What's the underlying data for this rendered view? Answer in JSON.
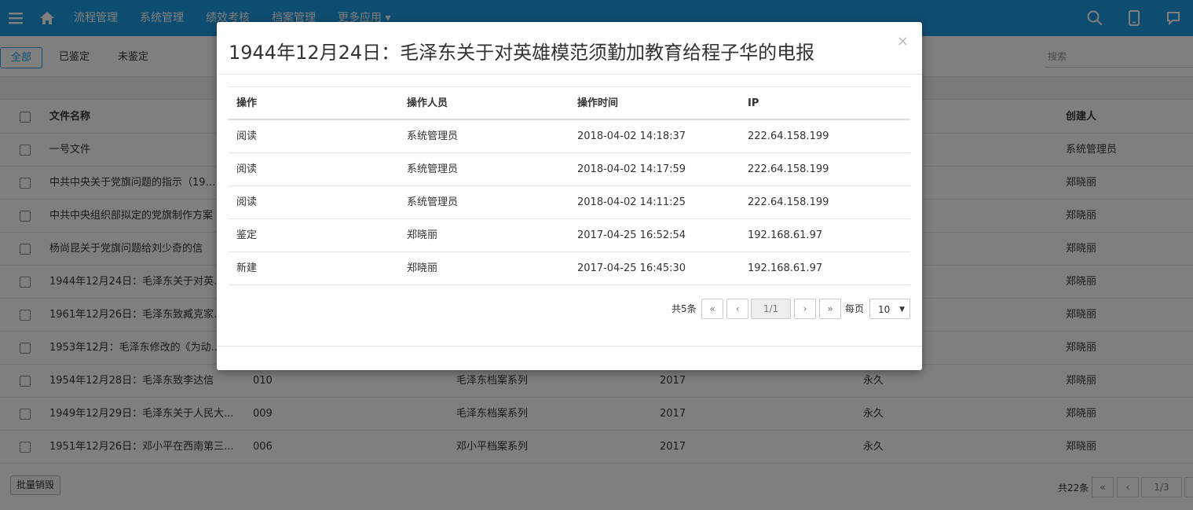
{
  "nav": {
    "items": [
      "流程管理",
      "系统管理",
      "绩效考核",
      "档案管理",
      "更多应用 ▾"
    ]
  },
  "filter": {
    "tabs": [
      "全部",
      "已鉴定",
      "未鉴定"
    ],
    "search_placeholder": "搜索"
  },
  "main_table": {
    "headers": {
      "name": "文件名称",
      "creator": "创建人"
    },
    "rows": [
      {
        "name": "一号文件",
        "code": "",
        "series": "",
        "year": "",
        "term": "",
        "creator": "系统管理员"
      },
      {
        "name": "中共中央关于党旗问题的指示（19…",
        "code": "",
        "series": "",
        "year": "",
        "term": "",
        "creator": "郑晓丽"
      },
      {
        "name": "中共中央组织部拟定的党旗制作方案",
        "code": "",
        "series": "",
        "year": "",
        "term": "",
        "creator": "郑晓丽"
      },
      {
        "name": "杨尚昆关于党旗问题给刘少奇的信",
        "code": "",
        "series": "",
        "year": "",
        "term": "",
        "creator": "郑晓丽"
      },
      {
        "name": "1944年12月24日：毛泽东关于对英…",
        "code": "",
        "series": "",
        "year": "",
        "term": "",
        "creator": "郑晓丽"
      },
      {
        "name": "1961年12月26日：毛泽东致臧克家…",
        "code": "",
        "series": "",
        "year": "",
        "term": "",
        "creator": "郑晓丽"
      },
      {
        "name": "1953年12月：毛泽东修改的《为动…",
        "code": "",
        "series": "",
        "year": "",
        "term": "",
        "creator": "郑晓丽"
      },
      {
        "name": "1954年12月28日：毛泽东致李达信",
        "code": "010",
        "series": "毛泽东档案系列",
        "year": "2017",
        "term": "永久",
        "creator": "郑晓丽"
      },
      {
        "name": "1949年12月29日：毛泽东关于人民大...",
        "code": "009",
        "series": "毛泽东档案系列",
        "year": "2017",
        "term": "永久",
        "creator": "郑晓丽"
      },
      {
        "name": "1951年12月26日：邓小平在西南第三...",
        "code": "006",
        "series": "邓小平档案系列",
        "year": "2017",
        "term": "永久",
        "creator": "郑晓丽"
      }
    ],
    "batch_button": "批量销毁",
    "total": "共22条",
    "page": "1/3"
  },
  "modal": {
    "title": "1944年12月24日：毛泽东关于对英雄模范须勤加教育给程子华的电报",
    "close": "×",
    "headers": [
      "操作",
      "操作人员",
      "操作时间",
      "IP"
    ],
    "rows": [
      {
        "action": "阅读",
        "operator": "系统管理员",
        "time": "2018-04-02 14:18:37",
        "ip": "222.64.158.199"
      },
      {
        "action": "阅读",
        "operator": "系统管理员",
        "time": "2018-04-02 14:17:59",
        "ip": "222.64.158.199"
      },
      {
        "action": "阅读",
        "operator": "系统管理员",
        "time": "2018-04-02 14:11:25",
        "ip": "222.64.158.199"
      },
      {
        "action": "鉴定",
        "operator": "郑晓丽",
        "time": "2017-04-25 16:52:54",
        "ip": "192.168.61.97"
      },
      {
        "action": "新建",
        "operator": "郑晓丽",
        "time": "2017-04-25 16:45:30",
        "ip": "192.168.61.97"
      }
    ],
    "pagination": {
      "total": "共5条",
      "first": "«",
      "prev": "‹",
      "page": "1/1",
      "next": "›",
      "last": "»",
      "per_page_label": "每页",
      "per_page_value": "10"
    }
  },
  "colors": {
    "brand": "#1e9ae0",
    "overlay": "rgba(0,0,0,0.5)"
  }
}
